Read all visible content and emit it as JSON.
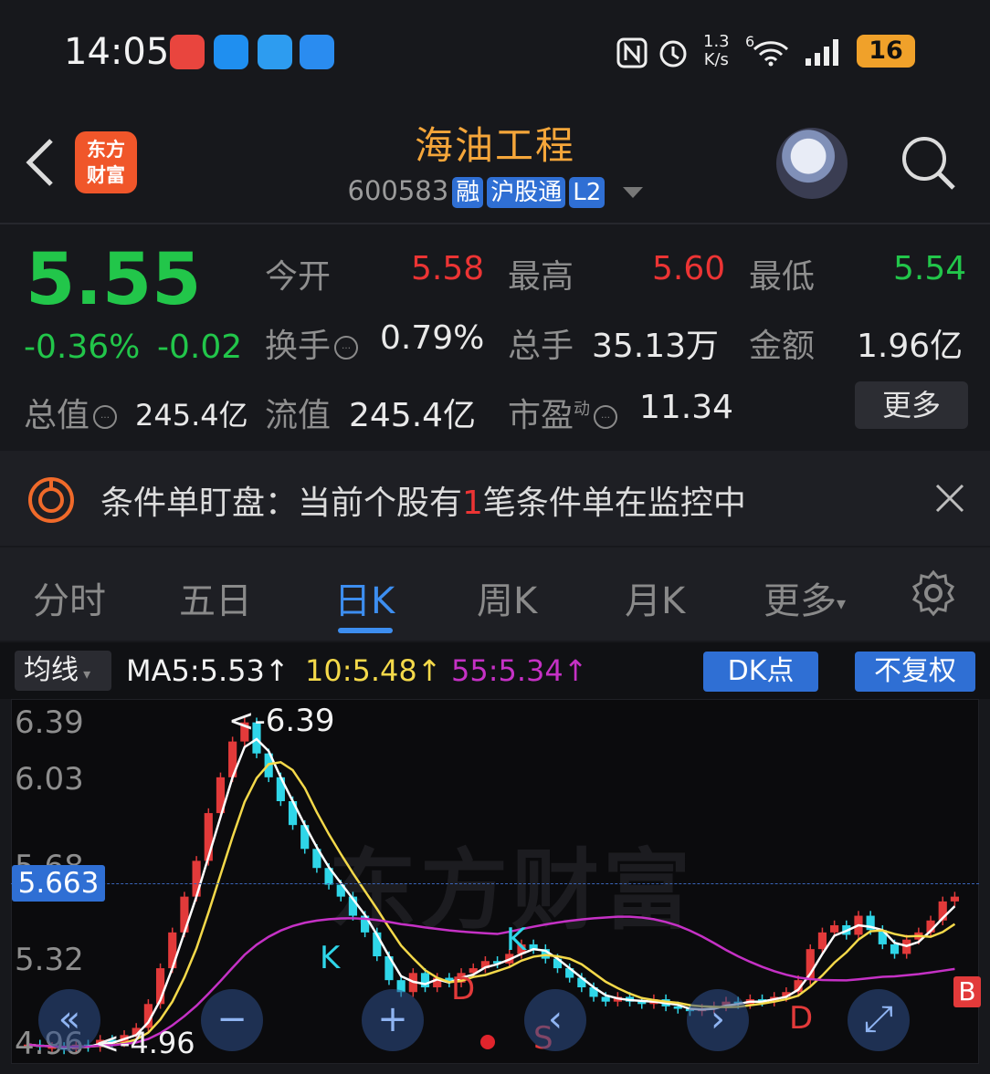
{
  "status_bar": {
    "time": "14:05",
    "net_speed_top": "1.3",
    "net_speed_bottom": "K/s",
    "wifi_badge": "6",
    "battery": "16"
  },
  "header": {
    "logo_line1": "东方",
    "logo_line2": "财富",
    "stock_name": "海油工程",
    "stock_code": "600583",
    "tags": [
      "融",
      "沪股通",
      "L2"
    ]
  },
  "quote": {
    "price": "5.55",
    "change_pct": "-0.36%",
    "change_abs": "-0.02",
    "open_label": "今开",
    "open_value": "5.58",
    "high_label": "最高",
    "high_value": "5.60",
    "low_label": "最低",
    "low_value": "5.54",
    "turnover_label": "换手",
    "turnover_value": "0.79%",
    "volume_label": "总手",
    "volume_value": "35.13万",
    "amount_label": "金额",
    "amount_value": "1.96亿",
    "total_value_label": "总值",
    "total_value_value": "245.4亿",
    "float_value_label": "流值",
    "float_value_value": "245.4亿",
    "pe_label": "市盈",
    "pe_super": "动",
    "pe_value": "11.34",
    "more_label": "更多"
  },
  "alert": {
    "prefix": "条件单盯盘：当前个股有",
    "count": "1",
    "suffix": "笔条件单在监控中"
  },
  "tabs": [
    {
      "label": "分时"
    },
    {
      "label": "五日"
    },
    {
      "label": "日K"
    },
    {
      "label": "周K"
    },
    {
      "label": "月K"
    },
    {
      "label": "更多"
    }
  ],
  "ma_bar": {
    "selector": "均线",
    "ma5": "MA5:5.53↑",
    "ma10": "10:5.48↑",
    "ma55": "55:5.34↑",
    "dk_button": "DK点",
    "adjust_button": "不复权"
  },
  "chart_data": {
    "type": "candlestick",
    "y_ticks": [
      "6.39",
      "6.03",
      "5.68",
      "5.32",
      "4.96"
    ],
    "ylim": [
      4.96,
      6.39
    ],
    "current_price_label": "5.663",
    "high_marker": "<-6.39",
    "low_marker": "<-4.96",
    "signal_marks": [
      "K",
      "D",
      "K",
      "S",
      "D",
      "B"
    ],
    "watermark": "东方财富",
    "colors": {
      "up": "#e23a3a",
      "down": "#2fd6e8",
      "ma5": "#ffffff",
      "ma10": "#f4d94a",
      "ma55": "#c531c5"
    }
  }
}
